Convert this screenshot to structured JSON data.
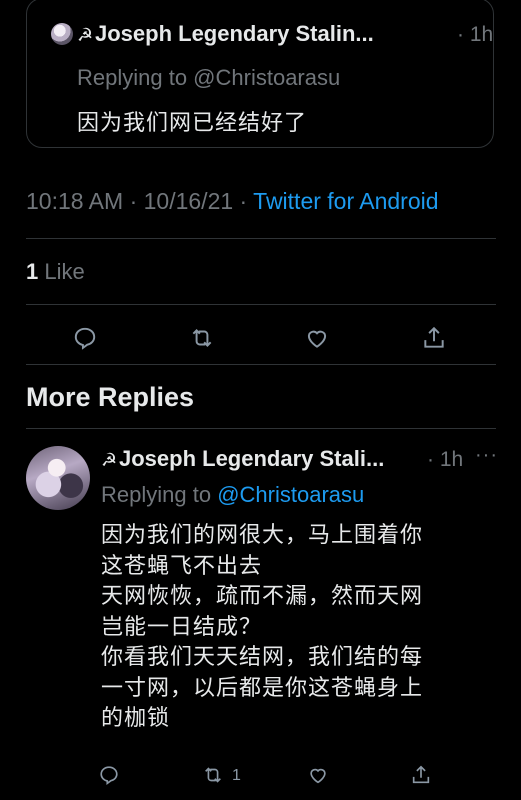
{
  "quoted": {
    "name_icon": "☭",
    "name": "Joseph Legendary Stalin...",
    "time": "· 1h",
    "replying": "Replying to @Christoarasu",
    "text": "因为我们网已经结好了"
  },
  "tweet_meta": {
    "time": "10:18 AM · 10/16/21 · ",
    "source": "Twitter for Android"
  },
  "likes": {
    "count": "1",
    "label": " Like"
  },
  "actions": [
    "reply-icon",
    "retweet-icon",
    "like-icon",
    "share-icon"
  ],
  "more_replies": {
    "title": "More Replies"
  },
  "reply": {
    "name_icon": "☭",
    "name": "Joseph Legendary Stali...",
    "time": "· 1h",
    "more": "···",
    "replying_prefix": "Replying to ",
    "replying_handle": "@Christoarasu",
    "lines": [
      "因为我们的网很大，马上围着你",
      "这苍蝇飞不出去",
      "天网恢恢，疏而不漏，然而天网",
      "岂能一日结成？",
      "你看我们天天结网，我们结的每",
      "一寸网，以后都是你这苍蝇身上",
      "的枷锁"
    ],
    "retweet_count": "1"
  },
  "colors": {
    "accent": "#1d9bf0",
    "muted": "#71767b",
    "border": "#2f3336"
  }
}
